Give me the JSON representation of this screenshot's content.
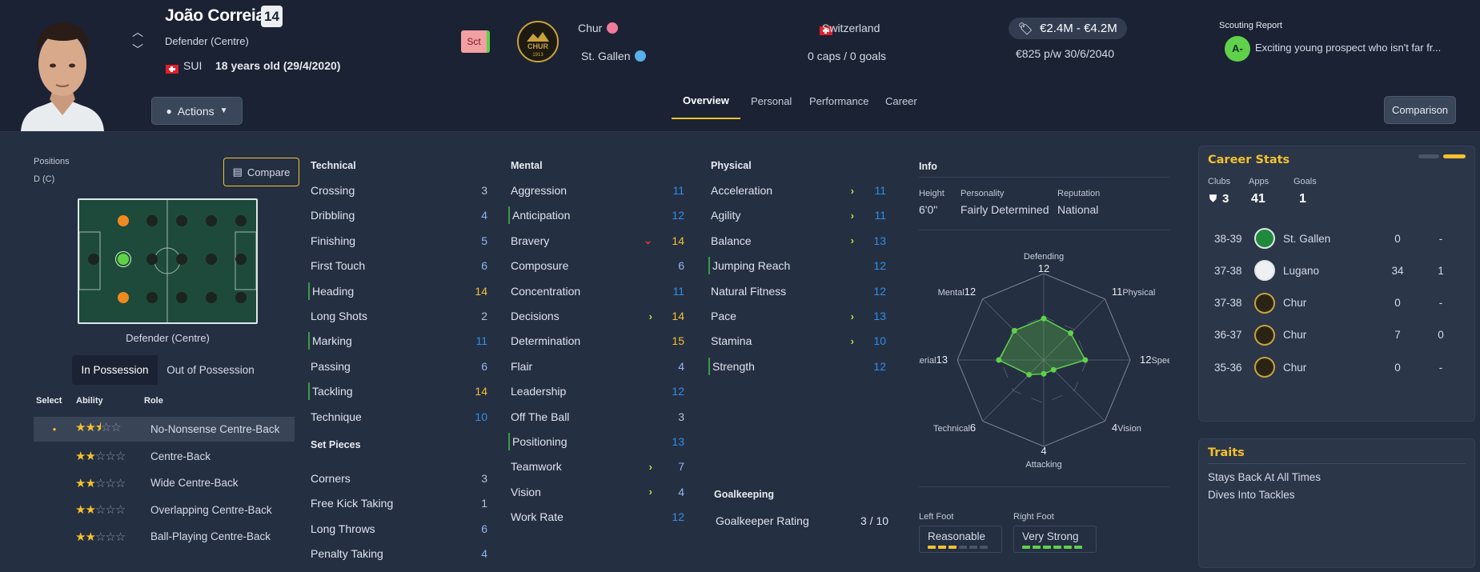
{
  "player": {
    "name": "João Correia",
    "number": "14",
    "position": "Defender (Centre)",
    "nation_code": "SUI",
    "age": "18 years old (29/4/2020)",
    "status_badge": "Sct"
  },
  "club": {
    "current": "Chur",
    "parent": "St. Gallen",
    "crest_text": "CHUR",
    "crest_year": "1913"
  },
  "nation": {
    "name": "Switzerland",
    "caps": "0 caps / 0 goals"
  },
  "value": {
    "range": "€2.4M - €4.2M",
    "wage": "€825 p/w 30/6/2040"
  },
  "scouting": {
    "title": "Scouting Report",
    "grade": "A-",
    "text": "Exciting young prospect who isn't far fr..."
  },
  "actions_label": "Actions",
  "comparison_label": "Comparison",
  "compare_label": "Compare",
  "tabs": [
    "Overview",
    "Personal",
    "Performance",
    "Career"
  ],
  "positions": {
    "title": "Positions",
    "value": "D (C)",
    "pitch_label": "Defender (Centre)"
  },
  "possession_tabs": [
    "In Possession",
    "Out of Possession"
  ],
  "roles_header": {
    "select": "Select",
    "ability": "Ability",
    "role": "Role"
  },
  "roles": [
    {
      "name": "No-Nonsense Centre-Back",
      "stars": 2.5,
      "selected": true
    },
    {
      "name": "Centre-Back",
      "stars": 2,
      "selected": false
    },
    {
      "name": "Wide Centre-Back",
      "stars": 2,
      "selected": false
    },
    {
      "name": "Overlapping Centre-Back",
      "stars": 2,
      "selected": false
    },
    {
      "name": "Ball-Playing Centre-Back",
      "stars": 2,
      "selected": false
    }
  ],
  "technical": {
    "title": "Technical",
    "items": [
      {
        "name": "Crossing",
        "value": "3",
        "c": "vw"
      },
      {
        "name": "Dribbling",
        "value": "4",
        "c": "vbl"
      },
      {
        "name": "Finishing",
        "value": "5",
        "c": "vbl"
      },
      {
        "name": "First Touch",
        "value": "6",
        "c": "vbl"
      },
      {
        "name": "Heading",
        "value": "14",
        "c": "vy",
        "bar": true
      },
      {
        "name": "Long Shots",
        "value": "2",
        "c": "vw"
      },
      {
        "name": "Marking",
        "value": "11",
        "c": "vb",
        "bar": true
      },
      {
        "name": "Passing",
        "value": "6",
        "c": "vbl"
      },
      {
        "name": "Tackling",
        "value": "14",
        "c": "vy",
        "bar": true
      },
      {
        "name": "Technique",
        "value": "10",
        "c": "vb"
      }
    ]
  },
  "set_pieces": {
    "title": "Set Pieces",
    "items": [
      {
        "name": "Corners",
        "value": "3",
        "c": "vw"
      },
      {
        "name": "Free Kick Taking",
        "value": "1",
        "c": "vw"
      },
      {
        "name": "Long Throws",
        "value": "6",
        "c": "vbl"
      },
      {
        "name": "Penalty Taking",
        "value": "4",
        "c": "vbl"
      }
    ]
  },
  "mental": {
    "title": "Mental",
    "items": [
      {
        "name": "Aggression",
        "value": "11",
        "c": "vb"
      },
      {
        "name": "Anticipation",
        "value": "12",
        "c": "vb",
        "bar": true
      },
      {
        "name": "Bravery",
        "value": "14",
        "c": "vy",
        "arrow": "down"
      },
      {
        "name": "Composure",
        "value": "6",
        "c": "vbl"
      },
      {
        "name": "Concentration",
        "value": "11",
        "c": "vb"
      },
      {
        "name": "Decisions",
        "value": "14",
        "c": "vy",
        "arrow": "up"
      },
      {
        "name": "Determination",
        "value": "15",
        "c": "vy"
      },
      {
        "name": "Flair",
        "value": "4",
        "c": "vbl"
      },
      {
        "name": "Leadership",
        "value": "12",
        "c": "vb"
      },
      {
        "name": "Off The Ball",
        "value": "3",
        "c": "vw"
      },
      {
        "name": "Positioning",
        "value": "13",
        "c": "vb",
        "bar": true
      },
      {
        "name": "Teamwork",
        "value": "7",
        "c": "vbl",
        "arrow": "up"
      },
      {
        "name": "Vision",
        "value": "4",
        "c": "vbl",
        "arrow": "up"
      },
      {
        "name": "Work Rate",
        "value": "12",
        "c": "vb"
      }
    ]
  },
  "physical": {
    "title": "Physical",
    "items": [
      {
        "name": "Acceleration",
        "value": "11",
        "c": "vb",
        "arrow": "up"
      },
      {
        "name": "Agility",
        "value": "11",
        "c": "vb",
        "arrow": "up"
      },
      {
        "name": "Balance",
        "value": "13",
        "c": "vb",
        "arrow": "up"
      },
      {
        "name": "Jumping Reach",
        "value": "12",
        "c": "vb",
        "bar": true
      },
      {
        "name": "Natural Fitness",
        "value": "12",
        "c": "vb"
      },
      {
        "name": "Pace",
        "value": "13",
        "c": "vb",
        "arrow": "up"
      },
      {
        "name": "Stamina",
        "value": "10",
        "c": "vb",
        "arrow": "up"
      },
      {
        "name": "Strength",
        "value": "12",
        "c": "vb",
        "bar": true
      }
    ]
  },
  "goalkeeping": {
    "title": "Goalkeeping",
    "label": "Goalkeeper Rating",
    "value": "3 / 10"
  },
  "info": {
    "title": "Info",
    "height_label": "Height",
    "height": "6'0\"",
    "personality_label": "Personality",
    "personality": "Fairly Determined",
    "reputation_label": "Reputation",
    "reputation": "National"
  },
  "radar": {
    "axes": [
      {
        "label": "Defending",
        "value": 12
      },
      {
        "label": "Physical",
        "value": 11
      },
      {
        "label": "Speed",
        "value": 12
      },
      {
        "label": "Vision",
        "value": 4
      },
      {
        "label": "Attacking",
        "value": 4
      },
      {
        "label": "Technical",
        "value": 6
      },
      {
        "label": "Aerial",
        "value": 13
      },
      {
        "label": "Mental",
        "value": 12
      }
    ],
    "max": 20
  },
  "feet": {
    "left_label": "Left Foot",
    "left": "Reasonable",
    "left_level": 3,
    "right_label": "Right Foot",
    "right": "Very Strong",
    "right_level": 6,
    "max_level": 6
  },
  "career": {
    "title": "Career Stats",
    "clubs_label": "Clubs",
    "clubs": "3",
    "apps_label": "Apps",
    "apps": "41",
    "goals_label": "Goals",
    "goals": "1",
    "rows": [
      {
        "season": "38-39",
        "club": "St. Gallen",
        "apps": "0",
        "goals": "-"
      },
      {
        "season": "37-38",
        "club": "Lugano",
        "apps": "34",
        "goals": "1"
      },
      {
        "season": "37-38",
        "club": "Chur",
        "apps": "0",
        "goals": "-"
      },
      {
        "season": "36-37",
        "club": "Chur",
        "apps": "7",
        "goals": "0"
      },
      {
        "season": "35-36",
        "club": "Chur",
        "apps": "0",
        "goals": "-"
      }
    ]
  },
  "traits": {
    "title": "Traits",
    "items": [
      "Stays Back At All Times",
      "Dives Into Tackles"
    ]
  },
  "colors": {
    "accent": "#f2c12e",
    "blue": "#2f8fe8",
    "green": "#5fd14a"
  }
}
